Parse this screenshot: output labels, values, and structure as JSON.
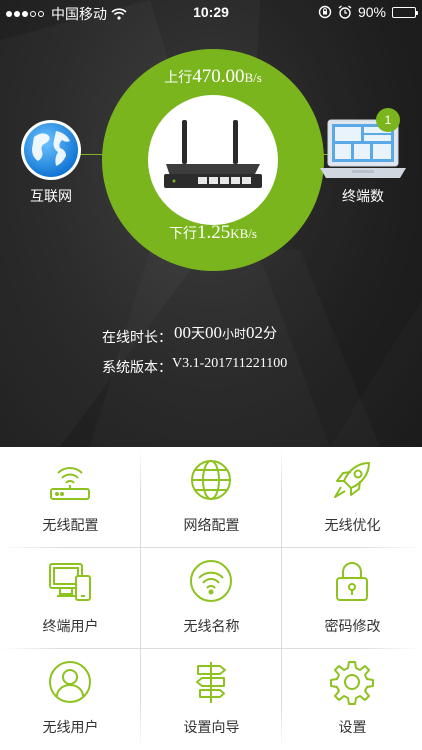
{
  "status_bar": {
    "carrier": "中国移动",
    "time": "10:29",
    "battery": "90%",
    "battery_level": 0.9
  },
  "colors": {
    "accent": "#7ab51d",
    "dark_bg": "#262626",
    "grid_bg": "#ffffff"
  },
  "traffic": {
    "upload_label": "上行",
    "upload_value": "470.00",
    "upload_unit": "B/s",
    "download_label": "下行",
    "download_value": "1.25",
    "download_unit": "KB/s"
  },
  "nodes": {
    "internet_label": "互联网",
    "terminals_label": "终端数",
    "terminals_count": "1"
  },
  "info": {
    "uptime_label": "在线时长：",
    "uptime_days": "00",
    "uptime_days_unit": "天",
    "uptime_hours": "00",
    "uptime_hours_unit": "小时",
    "uptime_minutes": "02",
    "uptime_minutes_unit": "分",
    "version_label": "系统版本：",
    "version_value": "V3.1-201711221100"
  },
  "menu": [
    {
      "label": "无线配置",
      "icon": "wifi-router-icon"
    },
    {
      "label": "网络配置",
      "icon": "globe-icon"
    },
    {
      "label": "无线优化",
      "icon": "rocket-icon"
    },
    {
      "label": "终端用户",
      "icon": "devices-icon"
    },
    {
      "label": "无线名称",
      "icon": "wifi-icon"
    },
    {
      "label": "密码修改",
      "icon": "lock-icon"
    },
    {
      "label": "无线用户",
      "icon": "user-icon"
    },
    {
      "label": "设置向导",
      "icon": "signpost-icon"
    },
    {
      "label": "设置",
      "icon": "gear-icon"
    }
  ]
}
